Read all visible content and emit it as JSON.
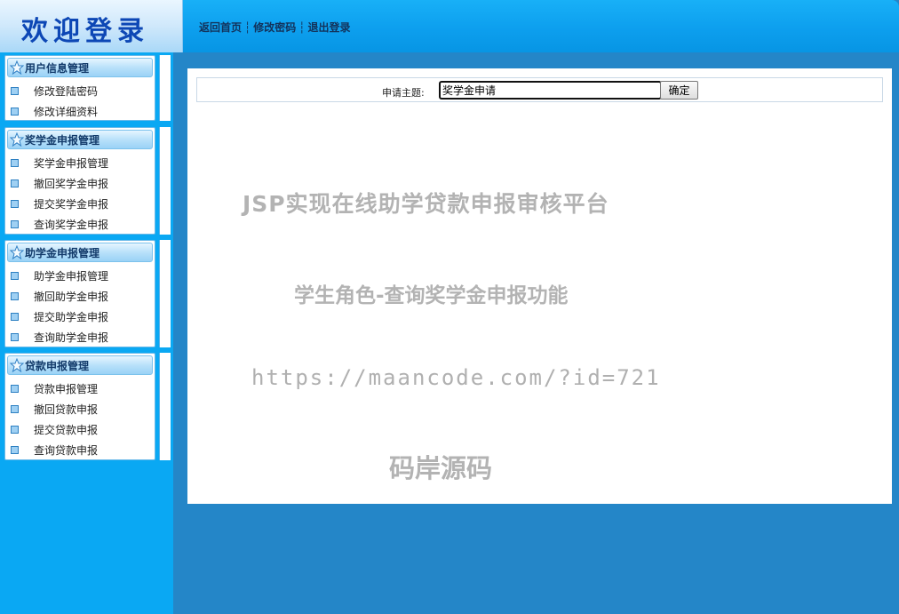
{
  "header": {
    "logo": "欢迎登录",
    "nav": [
      "返回首页",
      "修改密码",
      "退出登录"
    ]
  },
  "sidebar": [
    {
      "title": "用户信息管理",
      "items": [
        "修改登陆密码",
        "修改详细资料"
      ]
    },
    {
      "title": "奖学金申报管理",
      "items": [
        "奖学金申报管理",
        "撤回奖学金申报",
        "提交奖学金申报",
        "查询奖学金申报"
      ]
    },
    {
      "title": "助学金申报管理",
      "items": [
        "助学金申报管理",
        "撤回助学金申报",
        "提交助学金申报",
        "查询助学金申报"
      ]
    },
    {
      "title": "贷款申报管理",
      "items": [
        "贷款申报管理",
        "撤回贷款申报",
        "提交贷款申报",
        "查询贷款申报"
      ]
    }
  ],
  "form": {
    "label": "申请主题:",
    "value": "奖学金申请",
    "button": "确定"
  },
  "watermark": {
    "line1": "JSP实现在线助学贷款申报审核平台",
    "line2": "学生角色-查询奖学金申报功能",
    "line3": "https://maancode.com/?id=721",
    "line4": "码岸源码"
  }
}
